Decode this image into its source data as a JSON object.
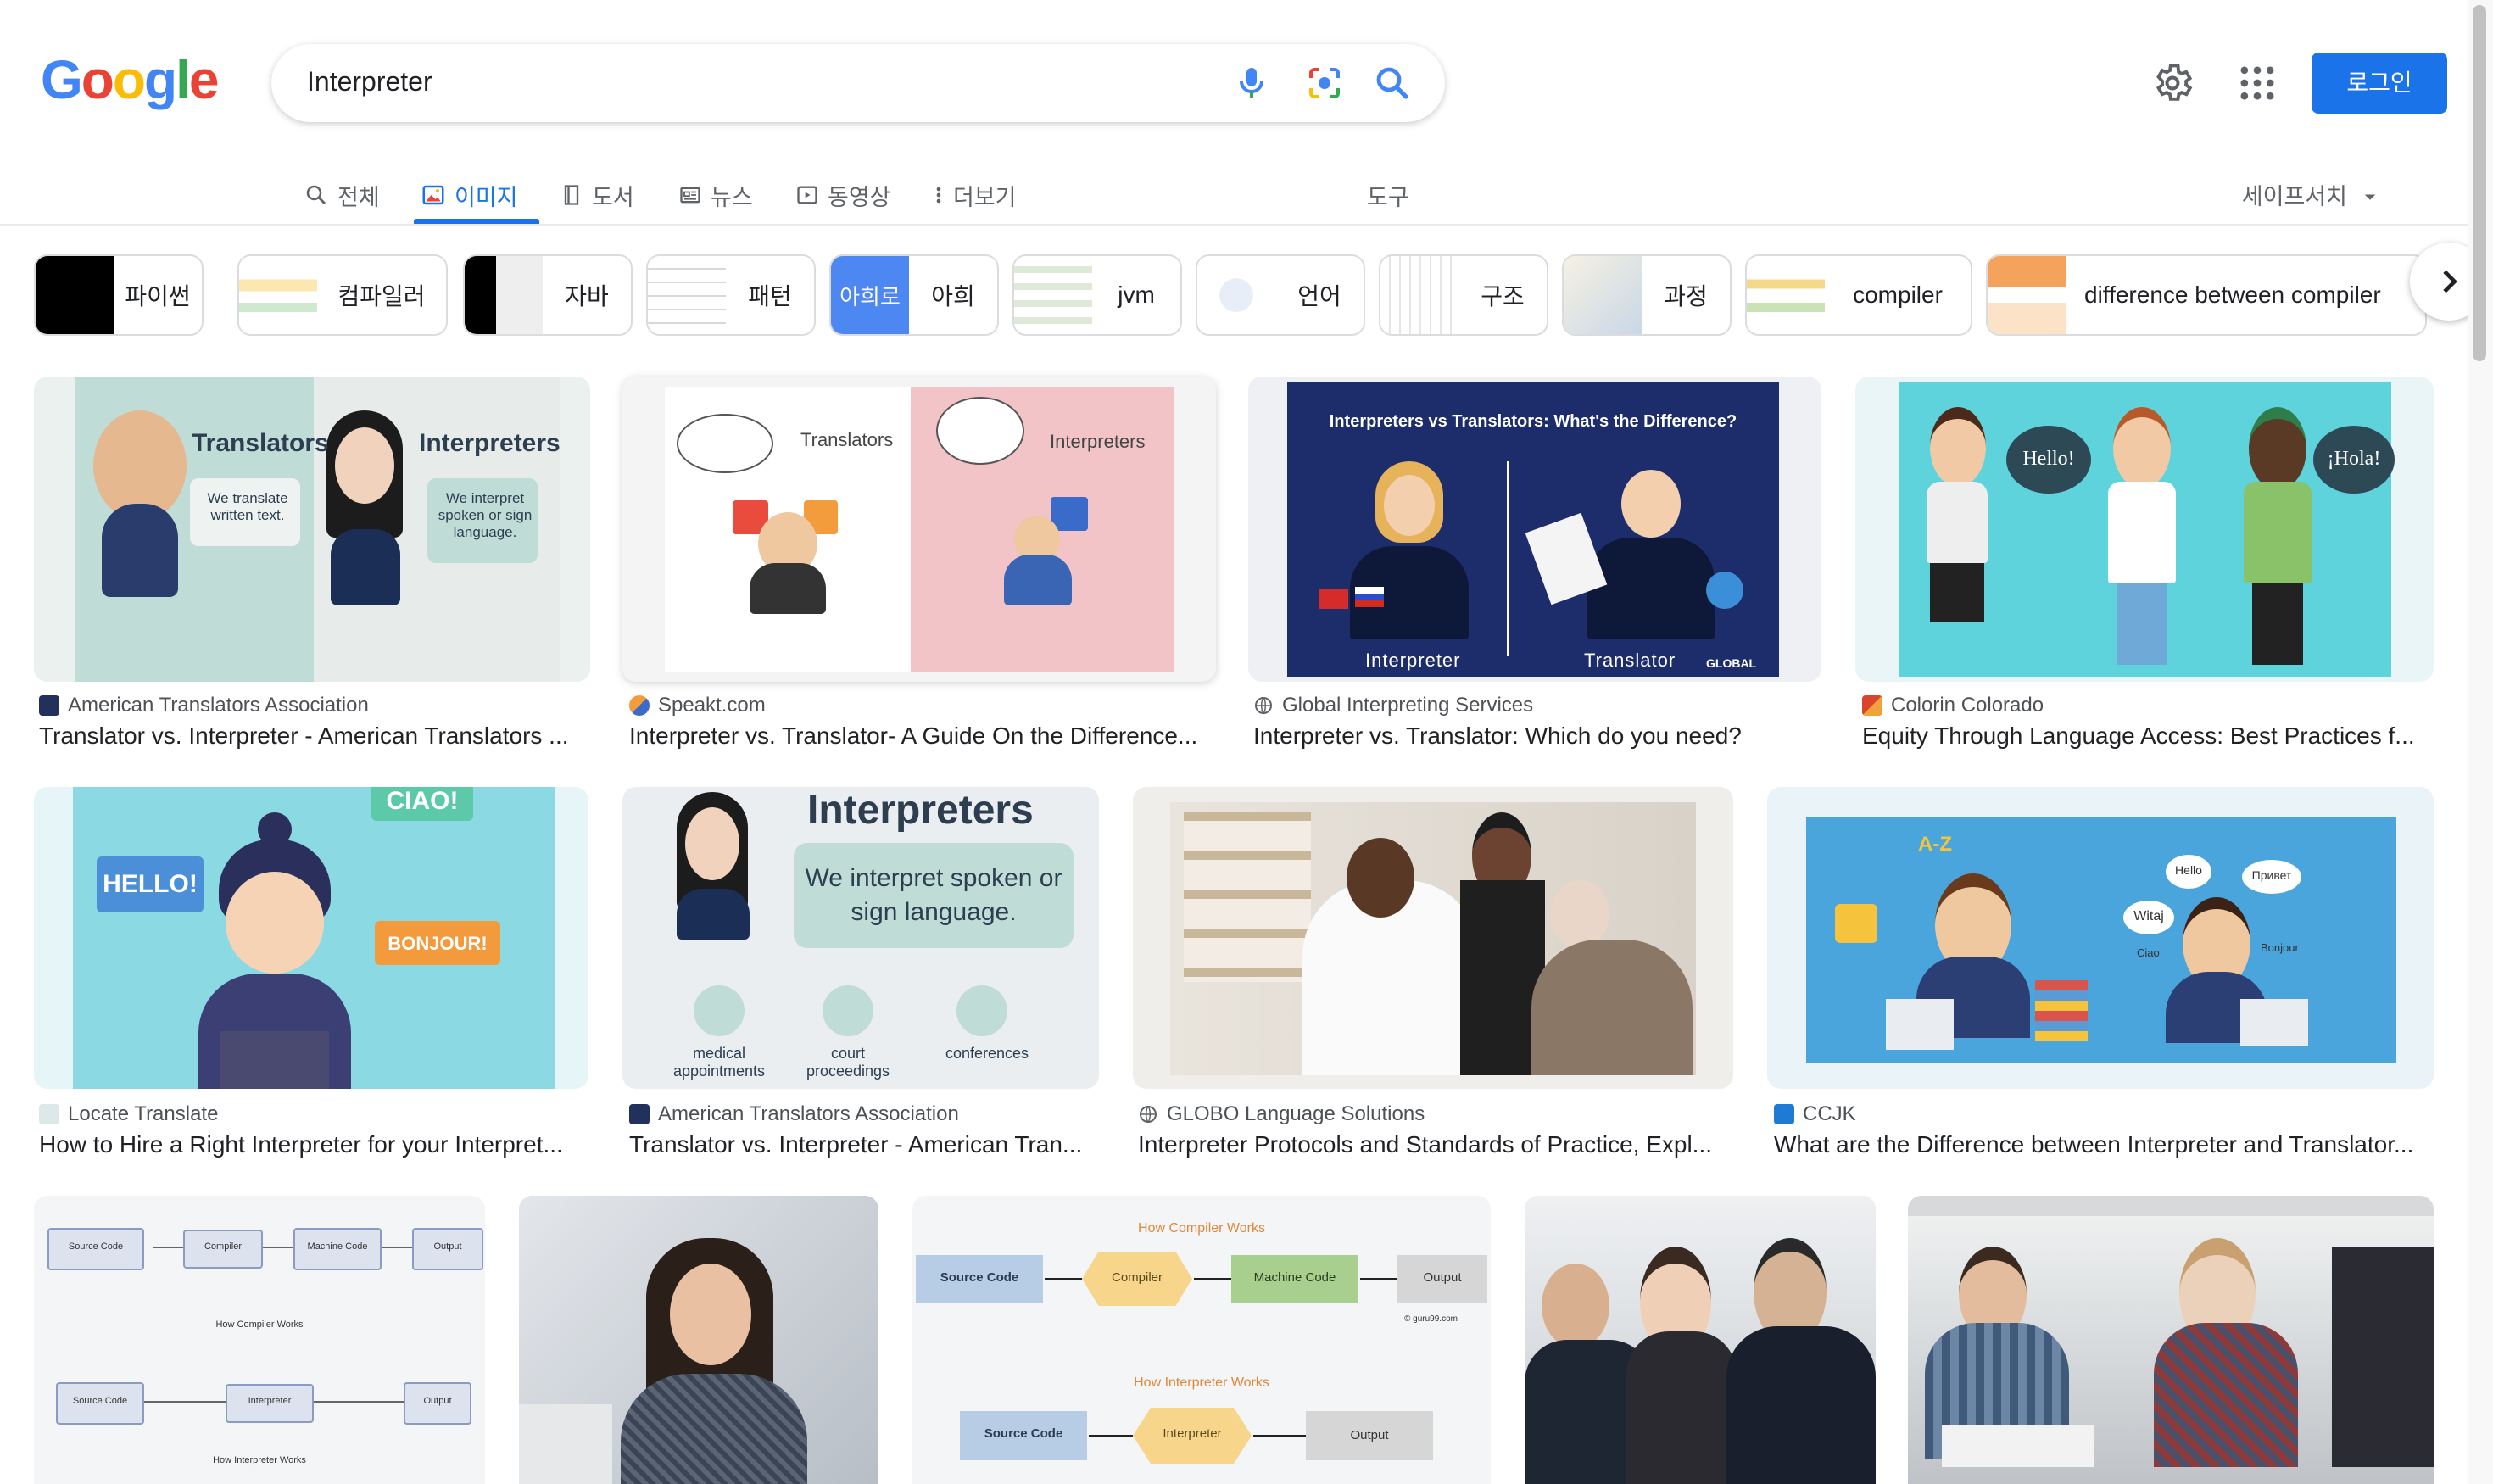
{
  "logo": {
    "text": "Google"
  },
  "search": {
    "query": "Interpreter"
  },
  "header": {
    "login_label": "로그인"
  },
  "tabs": [
    {
      "label": "전체",
      "icon": "search-icon"
    },
    {
      "label": "이미지",
      "icon": "image-icon",
      "active": true
    },
    {
      "label": "도서",
      "icon": "book-icon"
    },
    {
      "label": "뉴스",
      "icon": "news-icon"
    },
    {
      "label": "동영상",
      "icon": "video-icon"
    },
    {
      "label": "더보기",
      "icon": "more-vert-icon"
    }
  ],
  "tools_label": "도구",
  "safesearch_label": "세이프서치",
  "chips": [
    {
      "label": "파이썬"
    },
    {
      "label": "컴파일러"
    },
    {
      "label": "자바"
    },
    {
      "label": "패턴"
    },
    {
      "label": "아희",
      "prefix": "아희로"
    },
    {
      "label": "jvm"
    },
    {
      "label": "언어"
    },
    {
      "label": "구조"
    },
    {
      "label": "과정"
    },
    {
      "label": "compiler"
    },
    {
      "label": "difference between compiler"
    }
  ],
  "results_row1": [
    {
      "source": "American Translators Association",
      "title": "Translator vs. Interpreter - American Translators ..."
    },
    {
      "source": "Speakt.com",
      "title": "Interpreter vs. Translator- A Guide On the Difference..."
    },
    {
      "source": "Global Interpreting Services",
      "title": "Interpreter vs. Translator: Which do you need?"
    },
    {
      "source": "Colorin Colorado",
      "title": "Equity Through Language Access: Best Practices f..."
    }
  ],
  "results_row2": [
    {
      "source": "Locate Translate",
      "title": "How to Hire a Right Interpreter for your Interpret..."
    },
    {
      "source": "American Translators Association",
      "title": "Translator vs. Interpreter - American Tran..."
    },
    {
      "source": "GLOBO Language Solutions",
      "title": "Interpreter Protocols and Standards of Practice, Expl..."
    },
    {
      "source": "CCJK",
      "title": "What are the Difference between Interpreter and Translator..."
    }
  ],
  "image_text": {
    "ata1": {
      "translators": "Translators",
      "interpreters": "Interpreters",
      "t_desc": "We translate written text.",
      "i_desc": "We interpret spoken or sign language."
    },
    "speakt": {
      "translators": "Translators",
      "interpreters": "Interpreters"
    },
    "global": {
      "heading": "Interpreters vs Translators: What's the Difference?",
      "left": "Interpreter",
      "right": "Translator",
      "brand": "GLOBAL"
    },
    "colorin": {
      "hello": "Hello!",
      "hola": "¡Hola!"
    },
    "locate": {
      "hello": "HELLO!",
      "ciao": "CIAO!",
      "bonjour": "BONJOUR!"
    },
    "ata2": {
      "heading": "Interpreters",
      "desc": "We interpret spoken or sign language.",
      "c1": "medical appointments",
      "c2": "court proceedings",
      "c3": "conferences"
    },
    "ccjk": {
      "az": "A-Z",
      "hello": "Hello",
      "privet": "Привет",
      "witaj": "Witaj",
      "ciao": "Ciao",
      "bonjour": "Bonjour"
    },
    "compiler1": {
      "source": "Source Code",
      "compiler": "Compiler",
      "machine": "Machine Code",
      "output": "Output",
      "caption1": "How Compiler Works",
      "interpreter": "Interpreter",
      "caption2": "How Interpreter Works"
    },
    "compiler2": {
      "title1": "How Compiler Works",
      "source": "Source Code",
      "compiler": "Compiler",
      "machine": "Machine Code",
      "output": "Output",
      "brand": "© guru99.com",
      "title2": "How Interpreter Works",
      "interpreter": "Interpreter"
    }
  }
}
